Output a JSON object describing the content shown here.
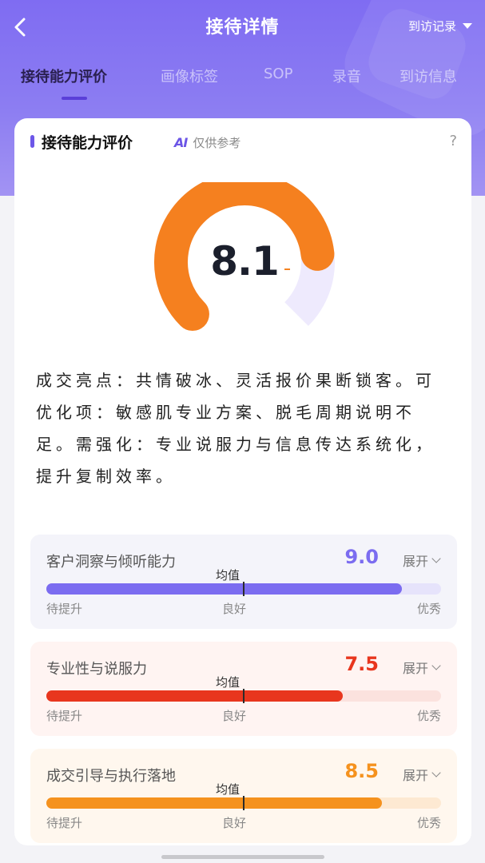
{
  "header": {
    "title": "接待详情",
    "visit_record": "到访记录"
  },
  "tabs": [
    {
      "label": "接待能力评价",
      "active": true
    },
    {
      "label": "画像标签",
      "active": false
    },
    {
      "label": "SOP",
      "active": false
    },
    {
      "label": "录音",
      "active": false
    },
    {
      "label": "到访信息",
      "active": false
    }
  ],
  "card": {
    "title": "接待能力评价",
    "ai_icon": "AI",
    "ai_note": "仅供参考",
    "help": "?",
    "score": "8.1",
    "score_value": 8.1,
    "score_max": 10,
    "summary": "成交亮点：共情破冰、灵活报价果断锁客。可优化项：敏感肌专业方案、脱毛周期说明不足。需强化：专业说服力与信息传达系统化，提升复制效率。"
  },
  "dimensions": [
    {
      "name": "客户洞察与倾听能力",
      "score": "9.0",
      "value": 0.9,
      "expand": "展开",
      "avg": "均值",
      "low": "待提升",
      "mid": "良好",
      "high": "优秀",
      "color": "#7b6cf0",
      "track": "#e6e3fb",
      "bg": "#f4f4fa"
    },
    {
      "name": "专业性与说服力",
      "score": "7.5",
      "value": 0.75,
      "expand": "展开",
      "avg": "均值",
      "low": "待提升",
      "mid": "良好",
      "high": "优秀",
      "color": "#e8361e",
      "track": "#fbe2de",
      "bg": "#fff4f2"
    },
    {
      "name": "成交引导与执行落地",
      "score": "8.5",
      "value": 0.85,
      "expand": "展开",
      "avg": "均值",
      "low": "待提升",
      "mid": "良好",
      "high": "优秀",
      "color": "#f5921e",
      "track": "#fde9d2",
      "bg": "#fff7ee"
    }
  ],
  "colors": {
    "accent": "#6d57e8",
    "gauge_orange": "#f5801f",
    "gauge_track": "#eeeafd"
  }
}
